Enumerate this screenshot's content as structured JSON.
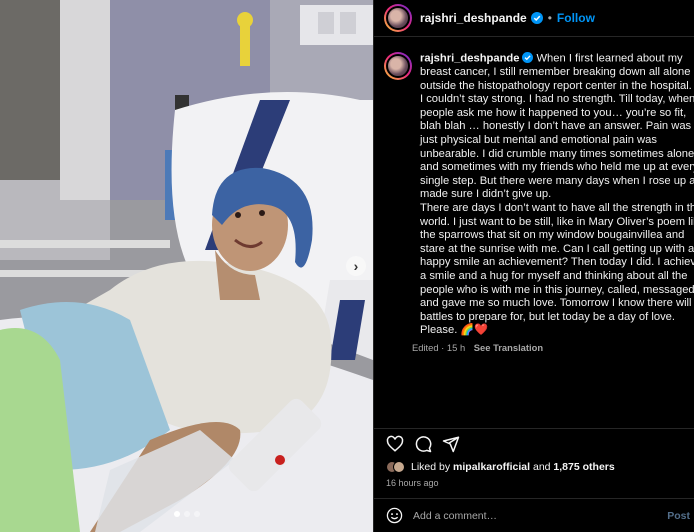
{
  "post": {
    "author": "rajshri_deshpande",
    "follow_label": "Follow",
    "separator": "•",
    "caption": "When I first learned about my breast cancer, I still remember breaking down all alone outside the histopathology report center in the hospital. No I couldn’t stay strong. I had no strength. Till today, when people ask me how it happened to you… you’re so fit, blah blah … honestly I don’t have an answer. Pain was not just physical but mental and emotional pain was unbearable. I did crumble many times sometimes alone and sometimes with my friends who held me up at every single step. But there were many days when I rose up and made sure I didn’t give up.\nThere are days I don’t want to have all the strength in the world. I just want to be still, like in Mary Oliver’s poem like the sparrows that sit on my window bougainvillea and stare at the sunrise with me. Can I call getting up with a happy smile an achievement? Then today I did. I achieved a smile and a hug for myself and thinking about all the people who is with me in this journey, called, messaged and gave me so much love. Tomorrow I know there will be battles to prepare for, but let today be a day of love. Please. 🌈❤️",
    "edited": "Edited · 15 h",
    "see_translation": "See Translation",
    "likes_prefix": "Liked by ",
    "likes_user": "mipalkarofficial",
    "likes_middle": " and ",
    "likes_count": "1,875 others",
    "time_ago": "16 hours ago",
    "comment_placeholder": "Add a comment…",
    "post_label": "Post",
    "carousel_next": "›"
  },
  "colors": {
    "accent": "#0095f6",
    "background": "#000000",
    "muted": "#a8a8a8"
  },
  "icons": {
    "verified": "verified-badge-icon",
    "like": "heart-icon",
    "comment": "comment-icon",
    "share": "share-icon",
    "emoji": "emoji-icon",
    "next": "chevron-right-icon"
  }
}
